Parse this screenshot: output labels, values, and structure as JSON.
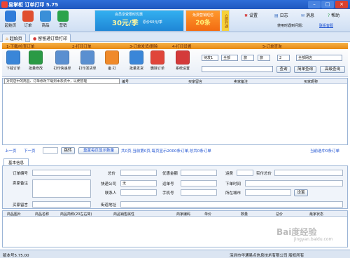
{
  "window": {
    "title": "易掌柜 订单打印 5.75"
  },
  "topnav": [
    {
      "label": "起始页",
      "color": "#2f7bd9"
    },
    {
      "label": "订单",
      "color": "#e04e2e"
    },
    {
      "label": "商品",
      "color": "#3a8fd8"
    },
    {
      "label": "营销",
      "color": "#2aa34a"
    }
  ],
  "banners": {
    "b1": {
      "top": "会员享受限时优惠",
      "main": "30元/季",
      "sub": "原价60元/季"
    },
    "b2": {
      "top": "免费营销短信",
      "main": "20条"
    },
    "b3": {
      "text": "立即开通"
    }
  },
  "right_tools": {
    "settings": "设置",
    "log": "日志",
    "messages": "消息",
    "help": "帮助",
    "user_hint": "使用时遇到问题：",
    "contact": "联系客服"
  },
  "tabs": [
    {
      "label": "起始页"
    },
    {
      "label": "留留通订单打印"
    }
  ],
  "sections": [
    "1-下载/检查订单",
    "2-打印订单",
    "3-订单发货/删除",
    "4-打印设置",
    "5-订单查询"
  ],
  "toolbar": [
    {
      "label": "下载订单",
      "color": "#3a86d8"
    },
    {
      "label": "批量修改",
      "color": "#2a9a45"
    },
    {
      "label": "打印快递单",
      "color": "#5a8fd0"
    },
    {
      "label": "打印发货单",
      "color": "#5a8fd0"
    },
    {
      "label": "备 打",
      "color": "#f08a2a"
    },
    {
      "label": "批量发货",
      "color": "#3a86d8"
    },
    {
      "label": "删除订单",
      "color": "#e0453a"
    },
    {
      "label": "系统设置",
      "color": "#d43a3a"
    }
  ],
  "query": {
    "sel1": "待发1",
    "sel2": "全部",
    "sel3": "旅",
    "sel4": "旅",
    "sel5": "2",
    "shop": "全部网店",
    "btn_query": "查询",
    "btn_simple": "简单查询",
    "btn_advanced": "高级查询"
  },
  "grid": {
    "hint": "对同店中的商品、订单修改下载到本系统中，以便管理",
    "headers": [
      "编号",
      "买家留言",
      "卖家备注",
      "买家昵称"
    ]
  },
  "pager": {
    "prev": "上一页",
    "next": "下一页",
    "go": "跳转",
    "reset": "重置每页显示数量",
    "info": "共0页,当前第0页,每页显示2000条订单,总共0条订单",
    "current": "当前选中0条订单"
  },
  "detail": {
    "tab": "基本信息",
    "fields": {
      "order_no": "订单编号",
      "total": "总价",
      "discount": "优惠金额",
      "freight": "运费",
      "paid": "实付总价",
      "remark": "卖家备注",
      "courier": "快递公司",
      "courier_val": "无",
      "waybill": "运单号",
      "order_time": "下单时间",
      "contact": "联系人",
      "mobile": "手机号",
      "city": "所在城市",
      "settings": "设置",
      "buyer_msg": "买家留言",
      "address": "街道地址"
    }
  },
  "items": {
    "headers": [
      "商品图片",
      "商品名称",
      "商品简称(20左右简)",
      "商品销售属性",
      "商家编码",
      "单价",
      "数量",
      "总价",
      "最家状态"
    ]
  },
  "status": {
    "version": "版本号5.75.00",
    "copyright": "深圳市华通易点信息技术有限公司 版权所有"
  },
  "watermark": {
    "main": "Bai度经验",
    "sub": "jingyan.baidu.com"
  }
}
